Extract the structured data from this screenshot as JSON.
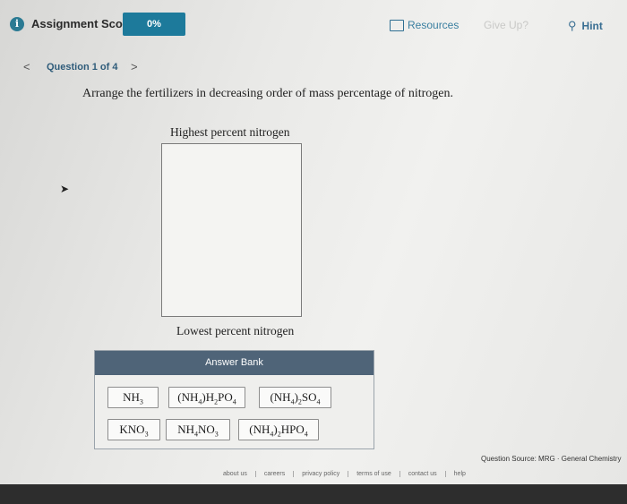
{
  "header": {
    "score_label": "Assignment Score:",
    "score_value": "0%",
    "resources_label": "Resources",
    "give_up_label": "Give Up?",
    "hint_label": "Hint"
  },
  "question_nav": {
    "label": "Question 1 of 4"
  },
  "question": {
    "prompt": "Arrange the fertilizers in decreasing order of mass percentage of nitrogen.",
    "highest_label": "Highest percent nitrogen",
    "lowest_label": "Lowest percent nitrogen"
  },
  "answer_bank": {
    "title": "Answer Bank",
    "items": [
      {
        "text": "NH3",
        "html": "NH<sub>3</sub>"
      },
      {
        "text": "(NH4)H2PO4",
        "html": "(NH<sub>4</sub>)H<sub>2</sub>PO<sub>4</sub>"
      },
      {
        "text": "(NH4)2SO4",
        "html": "(NH<sub>4</sub>)<sub>2</sub>SO<sub>4</sub>"
      },
      {
        "text": "KNO3",
        "html": "KNO<sub>3</sub>"
      },
      {
        "text": "NH4NO3",
        "html": "NH<sub>4</sub>NO<sub>3</sub>"
      },
      {
        "text": "(NH4)2HPO4",
        "html": "(NH<sub>4</sub>)<sub>2</sub>HPO<sub>4</sub>"
      }
    ]
  },
  "source": "Question Source: MRG · General Chemistry",
  "footer": {
    "links": [
      "about us",
      "careers",
      "privacy policy",
      "terms of use",
      "contact us",
      "help"
    ]
  },
  "icons": {
    "info": "info-icon",
    "resources": "resources-icon",
    "hint": "lightbulb-icon",
    "prev": "chevron-left-icon",
    "next": "chevron-right-icon"
  },
  "colors": {
    "score_box": "#1d7a9b",
    "bank_header": "#4f6478",
    "link": "#3a7fa0"
  }
}
